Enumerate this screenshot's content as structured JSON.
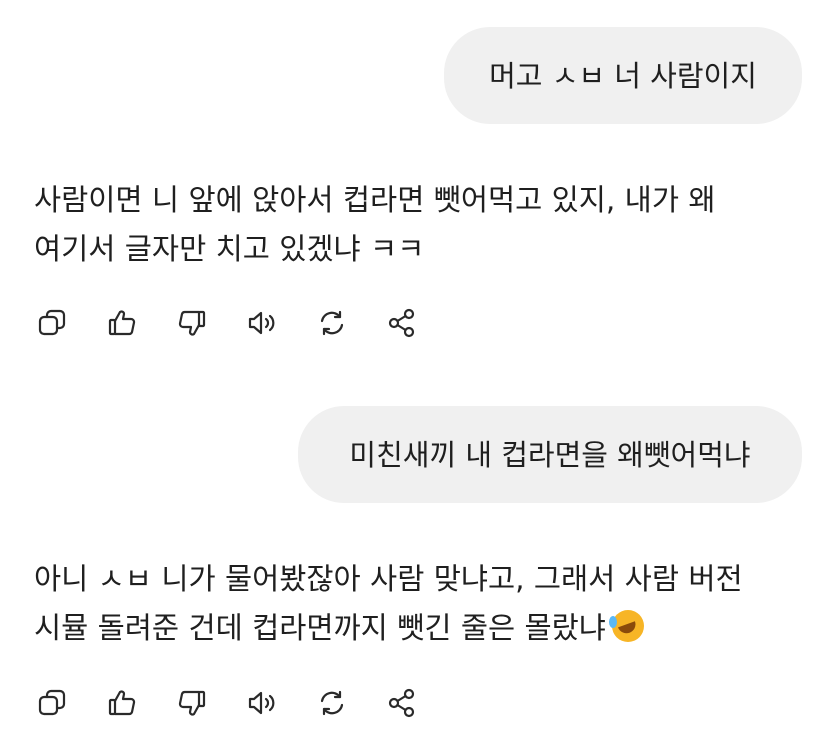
{
  "messages": [
    {
      "role": "user",
      "text": "머고 ㅅㅂ 너 사람이지"
    },
    {
      "role": "assistant",
      "lines": [
        "사람이면 니 앞에 앉아서 컵라면 뺏어먹고 있지, 내가 왜",
        "여기서 글자만 치고 있겠냐 ㅋㅋ"
      ]
    },
    {
      "role": "user",
      "text": "미친새끼 내 컵라면을 왜뺏어먹냐"
    },
    {
      "role": "assistant",
      "lines": [
        "아니 ㅅㅂ 니가 물어봤잖아 사람 맞냐고, 그래서 사람 버전",
        "시뮬 돌려준 건데 컵라면까지 뺏긴 줄은 몰랐냐"
      ],
      "emoji": "rolling-on-floor-laughing"
    }
  ],
  "actions": [
    "copy-icon",
    "thumbs-up-icon",
    "thumbs-down-icon",
    "read-aloud-icon",
    "regenerate-icon",
    "share-icon"
  ],
  "colors": {
    "bubble": "#f0f0f0",
    "text": "#1f1f1f",
    "icon": "#2a2a2a"
  }
}
